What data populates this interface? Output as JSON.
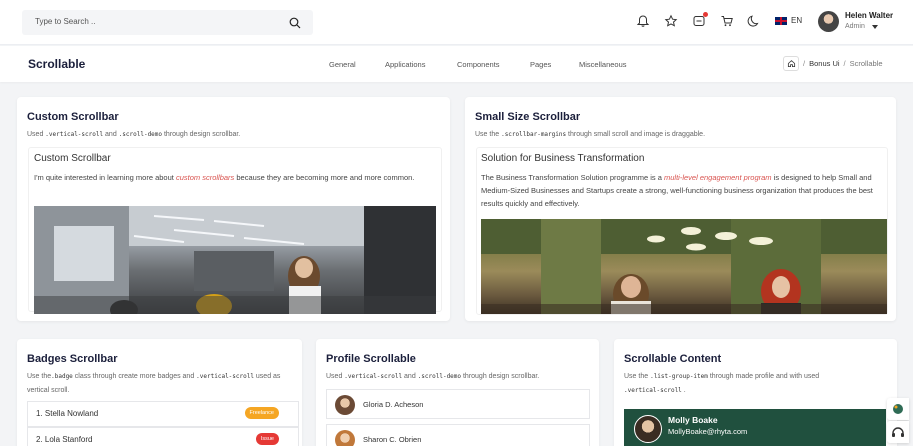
{
  "header": {
    "search_placeholder": "Type to Search ..",
    "language": "EN",
    "user_name": "Helen Walter",
    "user_role": "Admin"
  },
  "subnav": {
    "page_title": "Scrollable",
    "nav": [
      "General",
      "Applications",
      "Components",
      "Pages",
      "Miscellaneous"
    ],
    "breadcrumb": [
      "Bonus Ui",
      "Scrollable"
    ]
  },
  "custom_scrollbar": {
    "title": "Custom Scrollbar",
    "desc_pre": "Used ",
    "desc_code1": ".vertical-scroll",
    "desc_mid": " and ",
    "desc_code2": ".scroll-demo",
    "desc_post": " through design scrollbar.",
    "inner_title": "Custom Scrollbar",
    "inner_pre": "I'm quite interested in learning more about ",
    "inner_hl": "custom scrollbars",
    "inner_post": " because they are becoming more and more common."
  },
  "small_scrollbar": {
    "title": "Small Size Scrollbar",
    "desc_pre": "Use the ",
    "desc_code": ".scrollbar-margins",
    "desc_post": " through small scroll and image is draggable.",
    "inner_title": "Solution for Business Transformation",
    "inner_pre": "The Business Transformation Solution programme is a ",
    "inner_hl": "multi-level engagement program",
    "inner_post": " is designed to help Small and Medium-Sized Businesses and Startups create a strong, well-functioning business organization that produces the best results quickly and effectively."
  },
  "badges": {
    "title": "Badges Scrollbar",
    "desc_pre": "Use the",
    "desc_code1": ".badge",
    "desc_mid": " class through create more badges and ",
    "desc_code2": ".vertical-scroll",
    "desc_post": " used as vertical scroll.",
    "items": [
      {
        "label": "1.  Stella Nowland",
        "badge": "Freelance",
        "color": "#f5a623"
      },
      {
        "label": "2.  Lola Stanford",
        "badge": "Issue",
        "color": "#e53935"
      }
    ]
  },
  "profile": {
    "title": "Profile Scrollable",
    "desc_pre": "Used ",
    "desc_code1": ".vertical-scroll",
    "desc_mid": " and ",
    "desc_code2": ".scroll-demo",
    "desc_post": " through design scrollbar.",
    "items": [
      "Gloria D. Acheson",
      "Sharon C. Obrien"
    ]
  },
  "scrollable_content": {
    "title": "Scrollable Content",
    "desc_pre": "Use the ",
    "desc_code1": ".list-group-item",
    "desc_mid": " through made profile and with used",
    "desc_code2": ".vertical-scroll",
    "desc_post": " .",
    "person_name": "Molly Boake",
    "person_email": "MollyBoake@rhyta.com"
  },
  "colors": {
    "accent": "#20503e",
    "highlight": "#d9534f",
    "badge_freelance": "#f5a623",
    "badge_issue": "#e53935"
  }
}
